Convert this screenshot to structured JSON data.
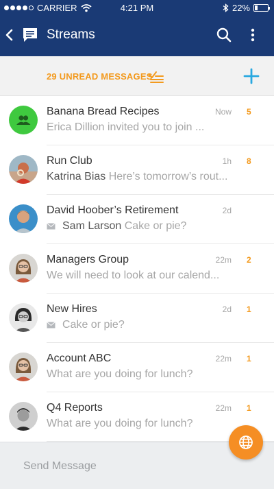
{
  "status_bar": {
    "carrier": "CARRIER",
    "time": "4:21 PM",
    "battery_text": "22%",
    "battery_level": 0.22
  },
  "nav": {
    "title": "Streams"
  },
  "unread": {
    "label": "29 UNREAD MESSAGES"
  },
  "streams": [
    {
      "title": "Banana Bread Recipes",
      "sender": "",
      "preview": "Erica Dillion invited you to join ...",
      "time": "Now",
      "badge": "5",
      "icon": "group-icon",
      "has_mail_icon": false
    },
    {
      "title": "Run Club",
      "sender": "Katrina Bias",
      "preview": "Here’s tomorrow’s rout...",
      "time": "1h",
      "badge": "8",
      "icon": "avatar",
      "has_mail_icon": false
    },
    {
      "title": "David Hoober’s Retirement",
      "sender": "Sam Larson",
      "preview": "Cake or pie?",
      "time": "2d",
      "badge": "",
      "icon": "avatar",
      "has_mail_icon": true
    },
    {
      "title": "Managers Group",
      "sender": "",
      "preview": "We will need to look at our calend...",
      "time": "22m",
      "badge": "2",
      "icon": "avatar",
      "has_mail_icon": false
    },
    {
      "title": "New Hires",
      "sender": "",
      "preview": "Cake or pie?",
      "time": "2d",
      "badge": "1",
      "icon": "avatar",
      "has_mail_icon": true
    },
    {
      "title": "Account ABC",
      "sender": "",
      "preview": "What are you doing for lunch?",
      "time": "22m",
      "badge": "1",
      "icon": "avatar",
      "has_mail_icon": false
    },
    {
      "title": "Q4 Reports",
      "sender": "",
      "preview": "What are you doing for lunch?",
      "time": "22m",
      "badge": "1",
      "icon": "avatar",
      "has_mail_icon": false
    }
  ],
  "composer": {
    "placeholder": "Send Message"
  },
  "colors": {
    "header": "#1a3a75",
    "accent_orange": "#f39a1e",
    "accent_blue": "#28a8e0",
    "group_green": "#3fc93f",
    "fab": "#f58e24"
  }
}
